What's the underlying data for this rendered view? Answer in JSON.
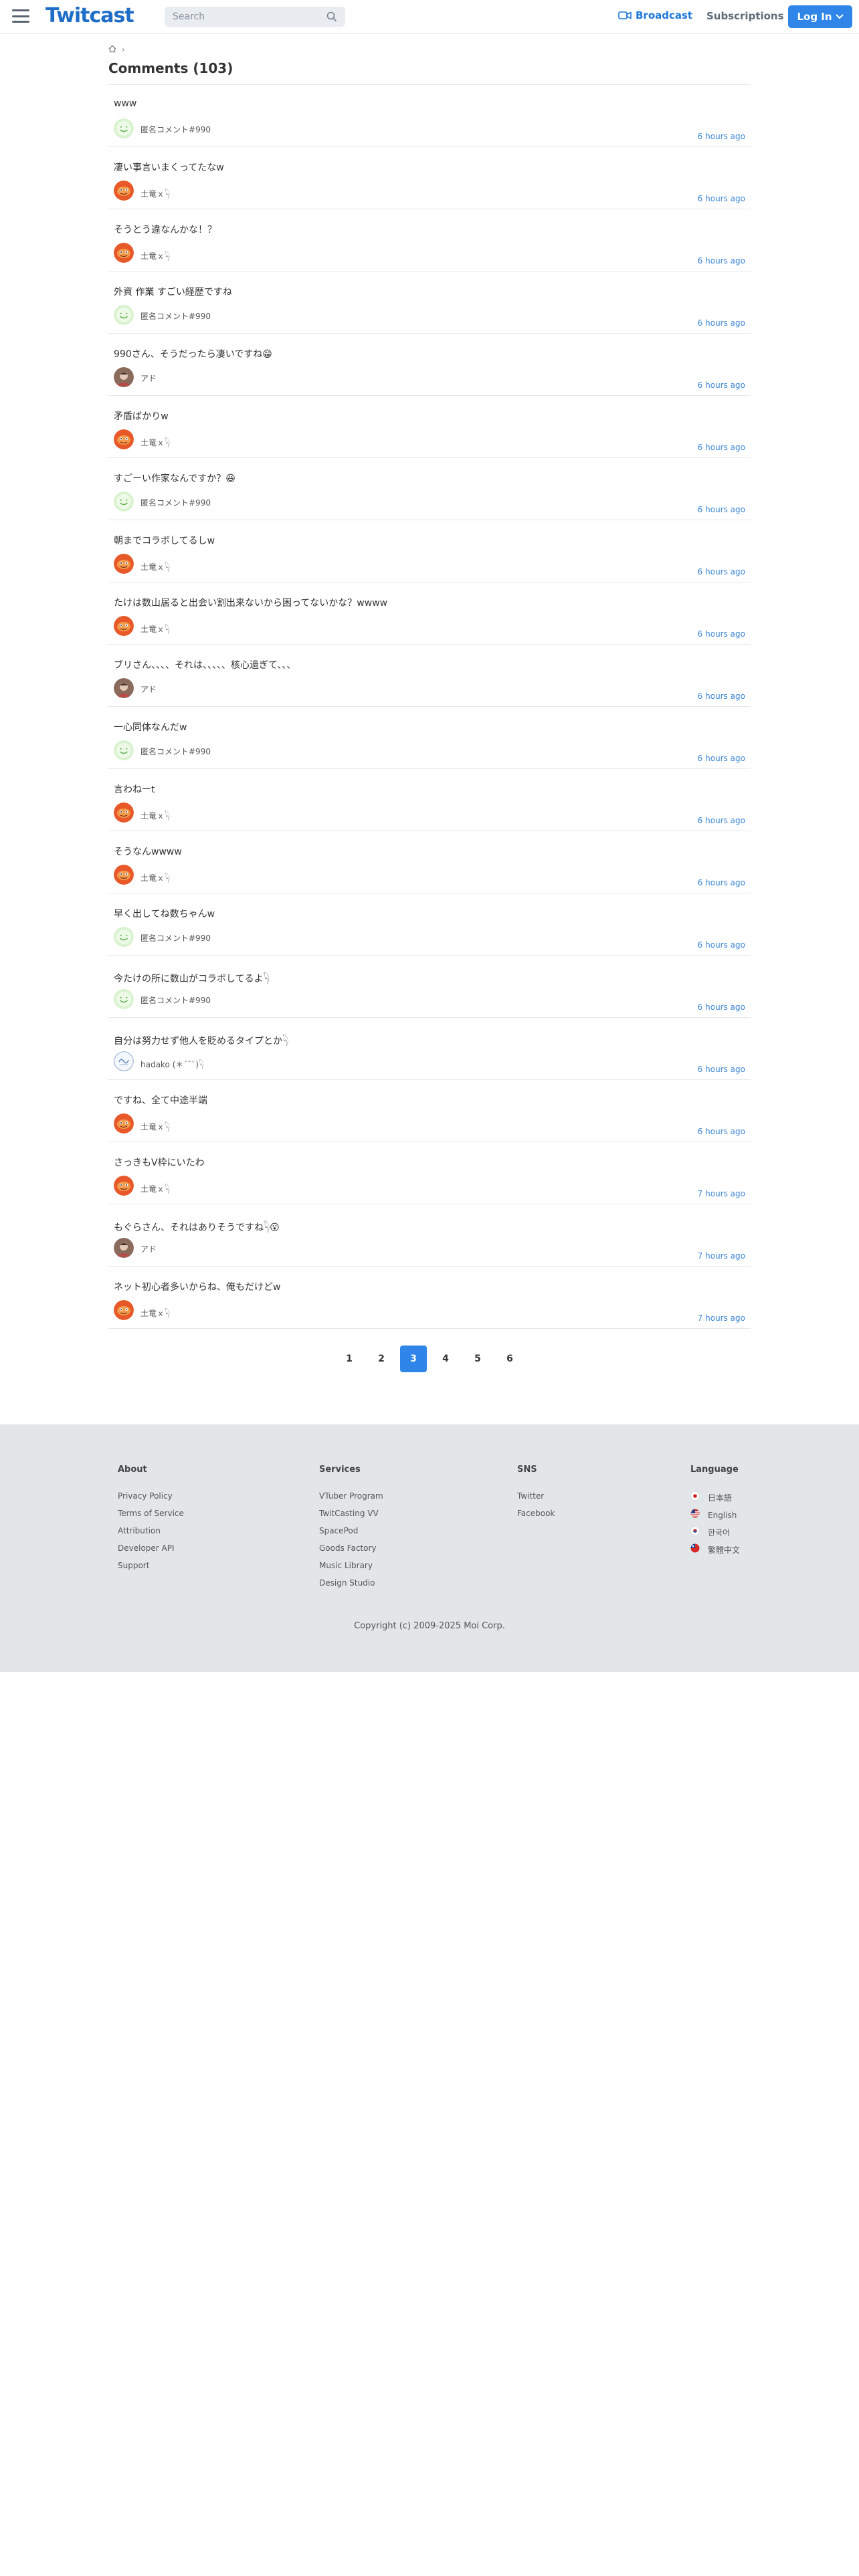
{
  "header": {
    "logo": "Twitcast",
    "search_placeholder": "Search",
    "broadcast": "Broadcast",
    "subscriptions": "Subscriptions",
    "login": "Log In"
  },
  "breadcrumb": {
    "separator": "›"
  },
  "page_title": "Comments (103)",
  "comments": [
    {
      "text": "www",
      "user": "匿名コメント#990",
      "time": "6 hours ago",
      "avatar": "green-smile"
    },
    {
      "text": "凄い事言いまくってたなw",
      "user": "土竜ｘ𓆐",
      "time": "6 hours ago",
      "avatar": "orange"
    },
    {
      "text": "そうとう違なんかな！？",
      "user": "土竜ｘ𓆐",
      "time": "6 hours ago",
      "avatar": "orange"
    },
    {
      "text": "外資 作業 すごい経歴ですね",
      "user": "匿名コメント#990",
      "time": "6 hours ago",
      "avatar": "green-smile"
    },
    {
      "text": "990さん、そうだったら凄いですね😁",
      "user": "アド",
      "time": "6 hours ago",
      "avatar": "brown"
    },
    {
      "text": "矛盾ばかりw",
      "user": "土竜ｘ𓆐",
      "time": "6 hours ago",
      "avatar": "orange"
    },
    {
      "text": "すごーい作家なんですか？😆",
      "user": "匿名コメント#990",
      "time": "6 hours ago",
      "avatar": "green-smile"
    },
    {
      "text": "朝までコラボしてるしw",
      "user": "土竜ｘ𓆐",
      "time": "6 hours ago",
      "avatar": "orange"
    },
    {
      "text": "たけは数山居ると出会い割出来ないから困ってないかな？wwww",
      "user": "土竜ｘ𓆐",
      "time": "6 hours ago",
      "avatar": "orange"
    },
    {
      "text": "ブリさん、、、、それは、、、、、核心過ぎて、、、",
      "user": "アド",
      "time": "6 hours ago",
      "avatar": "brown"
    },
    {
      "text": "一心同体なんだw",
      "user": "匿名コメント#990",
      "time": "6 hours ago",
      "avatar": "green-smile"
    },
    {
      "text": "言わねーt",
      "user": "土竜ｘ𓆐",
      "time": "6 hours ago",
      "avatar": "orange"
    },
    {
      "text": "そうなんwwww",
      "user": "土竜ｘ𓆐",
      "time": "6 hours ago",
      "avatar": "orange"
    },
    {
      "text": "早く出してね数ちゃんw",
      "user": "匿名コメント#990",
      "time": "6 hours ago",
      "avatar": "green-smile"
    },
    {
      "text": "今たけの所に数山がコラボしてるよ𓆐",
      "user": "匿名コメント#990",
      "time": "6 hours ago",
      "avatar": "green-smile"
    },
    {
      "text": "自分は努力せず他人を貶めるタイプとか𓆐",
      "user": "hadako (＊´¯`)𓆐",
      "time": "6 hours ago",
      "avatar": "blue-line"
    },
    {
      "text": "ですね、全て中途半端",
      "user": "土竜ｘ𓆐",
      "time": "6 hours ago",
      "avatar": "orange"
    },
    {
      "text": "さっきもV枠にいたわ",
      "user": "土竜ｘ𓆐",
      "time": "7 hours ago",
      "avatar": "orange"
    },
    {
      "text": "もぐらさん、それはありそうですね𓆐😮",
      "user": "アド",
      "time": "7 hours ago",
      "avatar": "brown"
    },
    {
      "text": "ネット初心者多いからね、俺もだけどw",
      "user": "土竜ｘ𓆐",
      "time": "7 hours ago",
      "avatar": "orange"
    }
  ],
  "pagination": {
    "pages": [
      "1",
      "2",
      "3",
      "4",
      "5",
      "6"
    ],
    "current": "3"
  },
  "footer": {
    "about": {
      "heading": "About",
      "links": [
        "Privacy Policy",
        "Terms of Service",
        "Attribution",
        "Developer API",
        "Support"
      ]
    },
    "services": {
      "heading": "Services",
      "links": [
        "VTuber Program",
        "TwitCasting VV",
        "SpacePod",
        "Goods Factory",
        "Music Library",
        "Design Studio"
      ]
    },
    "sns": {
      "heading": "SNS",
      "links": [
        "Twitter",
        "Facebook"
      ]
    },
    "language": {
      "heading": "Language",
      "links": [
        "日本語",
        "English",
        "한국어",
        "繁體中文"
      ]
    },
    "copyright": "Copyright (c) 2009-2025 Moi Corp."
  },
  "colors": {
    "brand": "#1e6ec8",
    "accent": "#2f86e8",
    "time_link": "#3d87d6",
    "footer_bg": "#e3e6e9"
  }
}
